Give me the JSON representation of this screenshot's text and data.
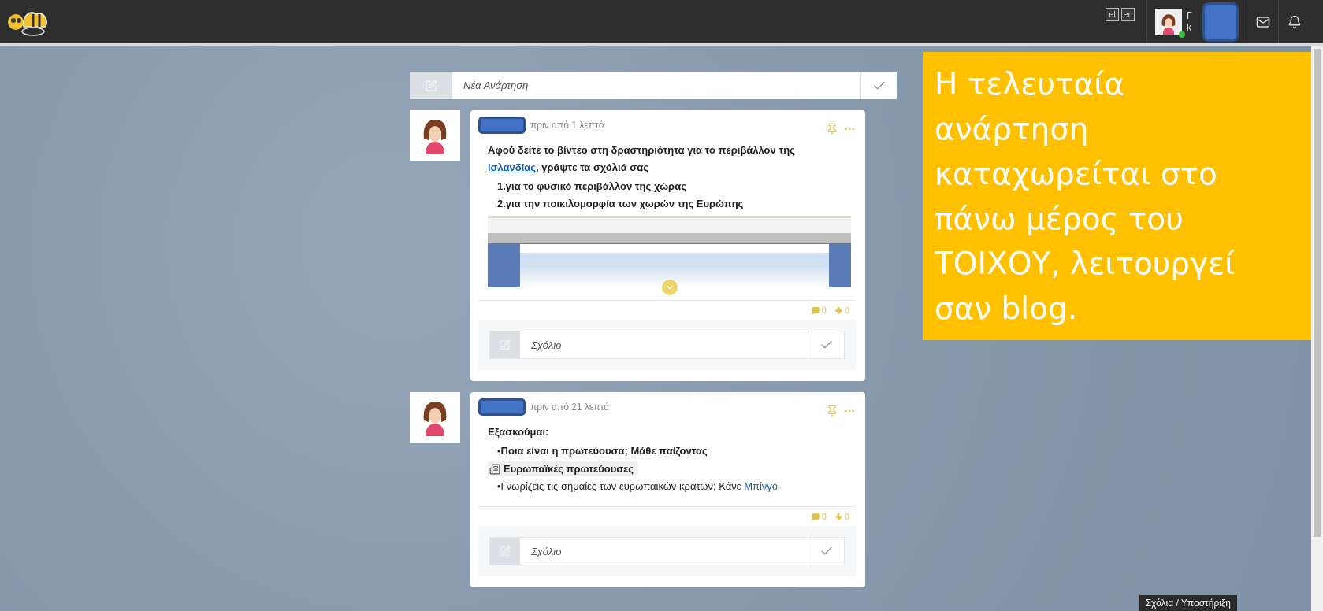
{
  "header": {
    "languages": [
      "el",
      "en"
    ],
    "user_initials": [
      "Γ",
      "k"
    ],
    "online": true
  },
  "new_post": {
    "placeholder": "Νέα Ανάρτηση"
  },
  "posts": [
    {
      "time": "πριν από 1 λεπτό",
      "blocks": [
        {
          "kind": "link_paragraph",
          "before": "Αφού δείτε το βίντεο  στη δραστηριότητα για το περιβάλλον της",
          "link": "Ισλανδίας",
          "after": ", γράψτε τα σχόλιά σας"
        },
        {
          "kind": "item",
          "bold": true,
          "text": "1.για το φυσικό περιβάλλον της χώρας"
        },
        {
          "kind": "item",
          "bold": true,
          "text": "2.για την ποικιλομορφία των χωρών της Ευρώπης"
        },
        {
          "kind": "media"
        }
      ],
      "comments_count": "0",
      "likes_count": "0",
      "comment_placeholder": "Σχόλιο"
    },
    {
      "time": "πριν από 21 λεπτά",
      "blocks": [
        {
          "kind": "heading",
          "text": "Εξασκούμαι:"
        },
        {
          "kind": "item",
          "bold": true,
          "text": "▪Ποια είναι η πρωτεύουσα; Μάθε παίζοντας"
        },
        {
          "kind": "tag",
          "text": "Ευρωπαϊκές πρωτεύουσες"
        },
        {
          "kind": "item_link",
          "text": "▪Γνωρίζεις τις σημαίες των ευρωπαϊκών κρατών; Κάνε ",
          "link": "Μπίνγο "
        }
      ],
      "comments_count": "0",
      "likes_count": "0",
      "comment_placeholder": "Σχόλιο"
    }
  ],
  "callout": {
    "text": "Η τελευταία ανάρτηση καταχωρείται στο πάνω μέρος του ΤΟΙΧΟΥ, λειτουργεί σαν blog."
  },
  "help_tab": {
    "label": "Σχόλια / Υποστήριξη"
  }
}
